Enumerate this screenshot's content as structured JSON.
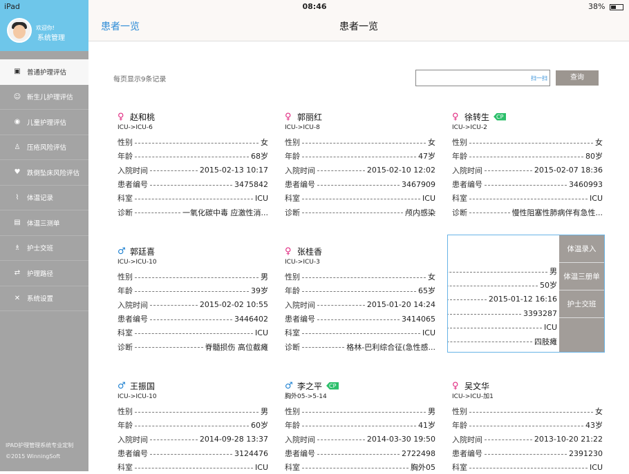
{
  "status_bar": {
    "device": "iPad",
    "time": "08:46",
    "battery": "38%"
  },
  "sidebar": {
    "welcome": "欢迎你!",
    "username": "系统管理",
    "items": [
      {
        "label": "普通护理评估",
        "icon": "medical-kit-icon"
      },
      {
        "label": "新生儿护理评估",
        "icon": "baby-icon"
      },
      {
        "label": "儿童护理评估",
        "icon": "eye-icon"
      },
      {
        "label": "压疮风险评估",
        "icon": "person-icon"
      },
      {
        "label": "跌倒坠床风险评估",
        "icon": "heart-icon"
      },
      {
        "label": "体温记录",
        "icon": "thermometer-icon"
      },
      {
        "label": "体温三测单",
        "icon": "chart-icon"
      },
      {
        "label": "护士交班",
        "icon": "nurse-icon"
      },
      {
        "label": "护理路径",
        "icon": "path-icon"
      },
      {
        "label": "系统设置",
        "icon": "wrench-icon"
      }
    ],
    "footer_line1": "IPAD护理管理系统专业定制",
    "footer_line2": "©2015 WinningSoft"
  },
  "navbar": {
    "back_label": "患者一览",
    "title": "患者一览"
  },
  "toolbar": {
    "page_size_text": "每页显示9条记录",
    "search_value": "",
    "scan_label": "扫一扫",
    "query_label": "查询"
  },
  "field_labels": {
    "gender": "性别",
    "age": "年龄",
    "admit": "入院时间",
    "pid": "患者编号",
    "dept": "科室",
    "diag": "诊断"
  },
  "cp_label": "CP",
  "actions": [
    "体温录入",
    "体温三册单",
    "护士交班"
  ],
  "patients": [
    {
      "name": "赵和桃",
      "gender_icon": "female",
      "cp": false,
      "ward": "ICU->ICU-6",
      "gender": "女",
      "age": "68岁",
      "admit": "2015-02-13 10:17",
      "pid": "3475842",
      "dept": "ICU",
      "diag": "一氧化碳中毒 应激性消..."
    },
    {
      "name": "郭丽红",
      "gender_icon": "female",
      "cp": false,
      "ward": "ICU->ICU-8",
      "gender": "女",
      "age": "47岁",
      "admit": "2015-02-10 12:02",
      "pid": "3467909",
      "dept": "ICU",
      "diag": "颅内感染"
    },
    {
      "name": "徐转生",
      "gender_icon": "female",
      "cp": true,
      "ward": "ICU->ICU-2",
      "gender": "女",
      "age": "80岁",
      "admit": "2015-02-07 18:36",
      "pid": "3460993",
      "dept": "ICU",
      "diag": "慢性阻塞性肺病伴有急性..."
    },
    {
      "name": "郭廷喜",
      "gender_icon": "male",
      "cp": false,
      "ward": "ICU->ICU-10",
      "gender": "男",
      "age": "39岁",
      "admit": "2015-02-02 10:55",
      "pid": "3446402",
      "dept": "ICU",
      "diag": "脊髓损伤 高位截瘫"
    },
    {
      "name": "张桂香",
      "gender_icon": "female",
      "cp": false,
      "ward": "ICU->ICU-3",
      "gender": "女",
      "age": "65岁",
      "admit": "2015-01-20 14:24",
      "pid": "3414065",
      "dept": "ICU",
      "diag": "格林-巴利综合征(急性感..."
    },
    {
      "name": "",
      "gender_icon": "",
      "cp": false,
      "ward": "",
      "gender": "男",
      "age": "50岁",
      "admit": "2015-01-12 16:16",
      "pid": "3393287",
      "dept": "ICU",
      "diag": "四肢瘫"
    },
    {
      "name": "王振国",
      "gender_icon": "male",
      "cp": false,
      "ward": "ICU->ICU-10",
      "gender": "男",
      "age": "60岁",
      "admit": "2014-09-28 13:37",
      "pid": "3124476",
      "dept": "ICU",
      "diag": ""
    },
    {
      "name": "李之平",
      "gender_icon": "male",
      "cp": true,
      "ward": "胸外05->5-14",
      "gender": "男",
      "age": "41岁",
      "admit": "2014-03-30 19:50",
      "pid": "2722498",
      "dept": "胸外05",
      "diag": ""
    },
    {
      "name": "吴文华",
      "gender_icon": "female",
      "cp": false,
      "ward": "ICU->ICU-加1",
      "gender": "女",
      "age": "43岁",
      "admit": "2013-10-20 21:22",
      "pid": "2391230",
      "dept": "ICU",
      "diag": ""
    }
  ]
}
